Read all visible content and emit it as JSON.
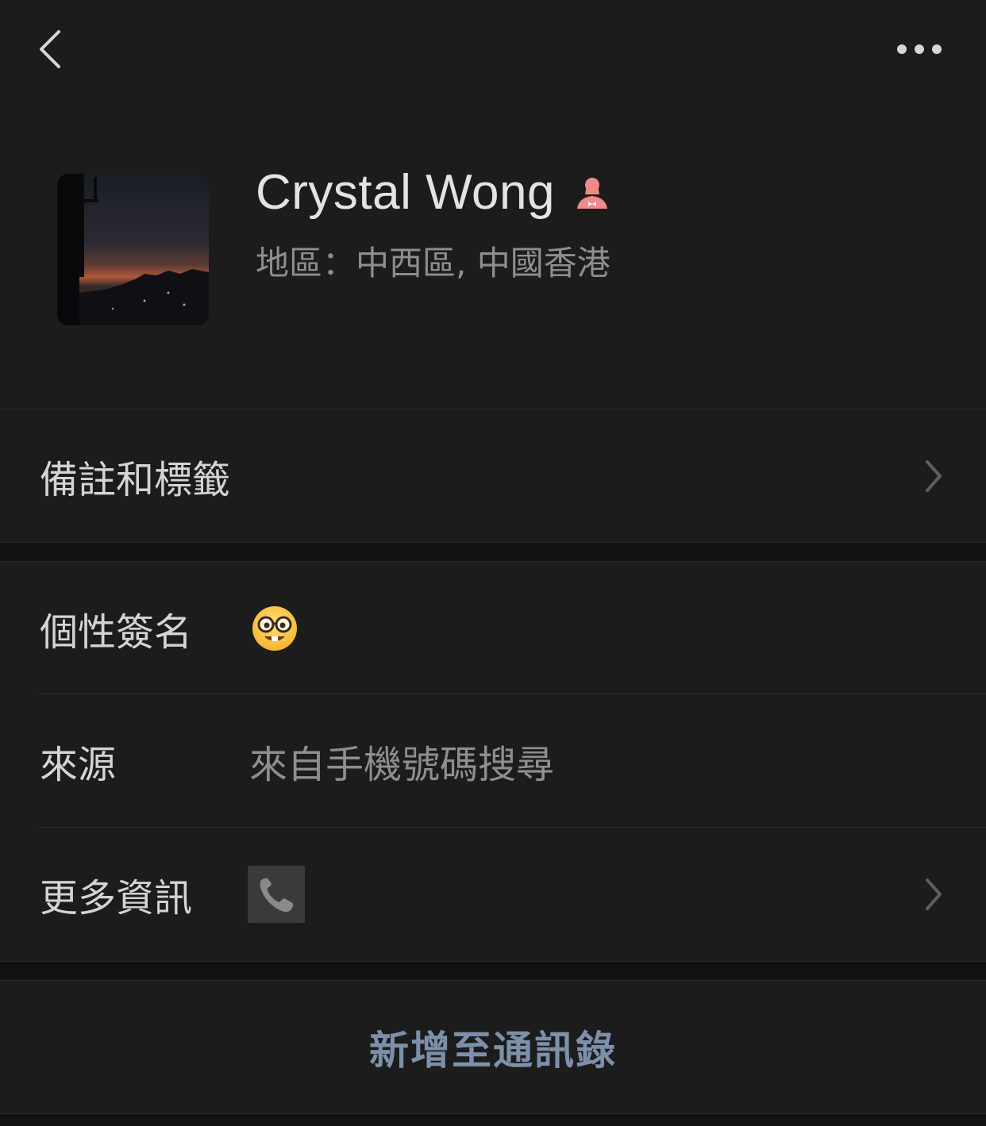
{
  "profile": {
    "name": "Crystal Wong",
    "region": "地區：中西區, 中國香港",
    "gender_icon": "female-icon",
    "avatar_description": "sunset-photo"
  },
  "rows": {
    "remark": {
      "label": "備註和標籤"
    },
    "signature": {
      "label": "個性簽名",
      "value_icon": "nerd-face-emoji"
    },
    "source": {
      "label": "來源",
      "value": "來自手機號碼搜尋"
    },
    "more_info": {
      "label": "更多資訊",
      "value_icon": "phone-icon"
    }
  },
  "action": {
    "label": "新增至通訊錄"
  },
  "colors": {
    "background": "#111111",
    "cell": "#1c1c1c",
    "primary_text": "#d4d4d4",
    "secondary_text": "#8e8e8e",
    "action_text": "#7d90a9",
    "female_icon": "#f08a8a"
  }
}
